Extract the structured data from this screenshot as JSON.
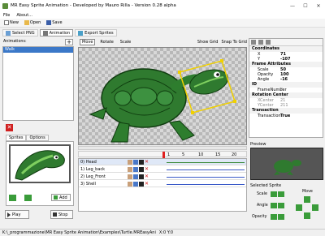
{
  "window": {
    "title": "MR Easy Sprite Animation - Developed by Mauro Rilla - Version 0.28 alpha"
  },
  "menu": {
    "file": "File",
    "about": "About..."
  },
  "toolbar": {
    "new": "New",
    "open": "Open",
    "save": "Save"
  },
  "tabs": {
    "select_png": "Select PNG",
    "animation": "Animation",
    "export": "Export Sprites"
  },
  "left": {
    "animations_label": "Animations:",
    "animations": [
      "Walk"
    ],
    "subtab_sprites": "Sprites",
    "subtab_options": "Options",
    "add_label": "Add",
    "play": "Play",
    "stop": "Stop"
  },
  "canvas": {
    "move": "Move",
    "rotate": "Rotate",
    "scale": "Scale",
    "show_grid": "Show Grid",
    "snap_to_grid": "Snap To Grid"
  },
  "timeline": {
    "ticks": [
      "1",
      "5",
      "10",
      "15",
      "20"
    ],
    "rows": [
      {
        "name": "0) Head"
      },
      {
        "name": "1) Leg_back"
      },
      {
        "name": "2) Leg_Front"
      },
      {
        "name": "3) Shell"
      }
    ]
  },
  "properties": {
    "coordinates": "Coordinates",
    "x_key": "X",
    "x_val": "71",
    "y_key": "Y",
    "y_val": "-107",
    "frame_attr": "Frame Attributes",
    "scale_key": "Scale",
    "scale_val": "50",
    "opacity_key": "Opacity",
    "opacity_val": "100",
    "angle_key": "Angle",
    "angle_val": "-16",
    "id": "ID",
    "frame_no_key": "FrameNumber",
    "frame_no_val": "0",
    "rotation_center": "Rotation Center",
    "xcenter_key": "XCenter",
    "xcenter_val": "21",
    "ycenter_key": "YCenter",
    "ycenter_val": "211",
    "transaction": "Transaction",
    "transaction_key": "Transaction",
    "transaction_val": "True"
  },
  "preview": {
    "label": "Preview",
    "selected_sprite": "Selected Sprite",
    "scale": "Scale",
    "angle": "Angle",
    "opacity": "Opacity",
    "move": "Move"
  },
  "status": {
    "path": "K:\\_programmazione\\MR Easy Sprite Animation\\Examples\\Turtle.MREasyAni",
    "xy": "X:0 Y:0"
  },
  "colors": {
    "accent": "#3b78c8",
    "delete": "#d02020",
    "arrow": "#3a9c3a",
    "turtle": "#2f7a2f",
    "selection": "#f0d000"
  }
}
